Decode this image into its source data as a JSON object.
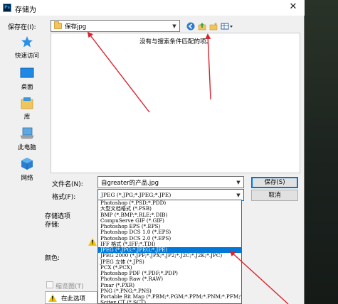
{
  "window": {
    "title": "存储为",
    "app_icon_text": "Ps",
    "close_glyph": "✕"
  },
  "save_in": {
    "label": "保存在(I):",
    "value": "保存jpg"
  },
  "places": [
    {
      "label": "快速访问",
      "icon": "star-icon"
    },
    {
      "label": "桌面",
      "icon": "desktop-icon"
    },
    {
      "label": "库",
      "icon": "library-icon"
    },
    {
      "label": "此电脑",
      "icon": "computer-icon"
    },
    {
      "label": "网络",
      "icon": "network-icon"
    }
  ],
  "file_list": {
    "empty_message": "没有与搜索条件匹配的项。"
  },
  "file_name": {
    "label": "文件名(N):",
    "value": "自greater的产品.jpg"
  },
  "format": {
    "label": "格式(F):",
    "value": "JPEG (*.JPG;*.JPEG;*.JPE)"
  },
  "buttons": {
    "save": "保存(S)",
    "cancel": "取消"
  },
  "options": {
    "save_options": "存储选项",
    "storage": "存储:",
    "color": "颜色:",
    "thumbnail": "缩览图(T)",
    "warning_text": "在此选项下，"
  },
  "format_options": [
    "Photoshop (*.PSD;*.PDD)",
    "大型文档格式 (*.PSB)",
    "BMP (*.BMP;*.RLE;*.DIB)",
    "CompuServe GIF (*.GIF)",
    "Photoshop EPS (*.EPS)",
    "Photoshop DCS 1.0 (*.EPS)",
    "Photoshop DCS 2.0 (*.EPS)",
    "IFF 格式 (*.IFF;*.TDI)",
    "JPEG (*.JPG;*.JPEG;*.JPE)",
    "JPEG 2000 (*.JPF;*.JPX;*.JP2;*.J2C;*.J2K;*.JPC)",
    "JPEG 立体 (*.JPS)",
    "PCX (*.PCX)",
    "Photoshop PDF (*.PDF;*.PDP)",
    "Photoshop Raw (*.RAW)",
    "Pixar (*.PXR)",
    "PNG (*.PNG;*.PNS)",
    "Portable Bit Map (*.PBM;*.PGM;*.PPM;*.PNM;*.PFM;*.PAM)",
    "Scitex CT (*.SCT)"
  ],
  "selected_format_index": 8,
  "colors": {
    "accent": "#0078d7",
    "annotation_arrow": "#d9232e"
  }
}
